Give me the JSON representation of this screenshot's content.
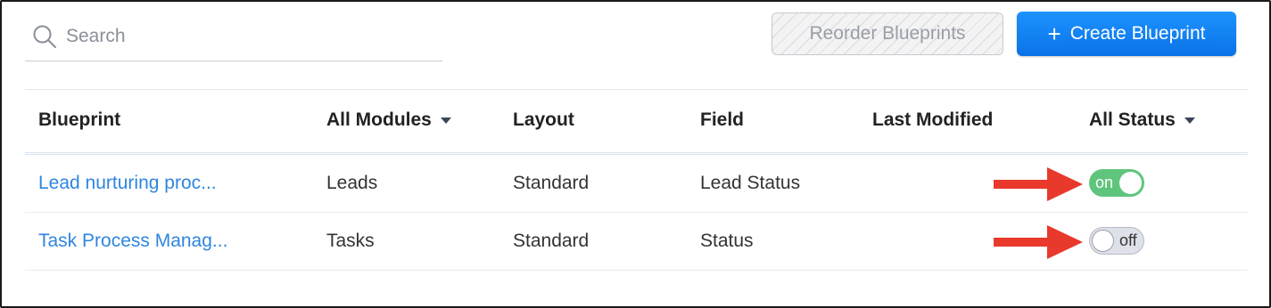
{
  "search": {
    "placeholder": "Search",
    "icon": "search-icon"
  },
  "toolbar": {
    "reorder_label": "Reorder Blueprints",
    "create_label": "Create Blueprint",
    "create_icon": "plus-icon",
    "accent": "#0a84ff"
  },
  "table": {
    "headers": {
      "blueprint": "Blueprint",
      "modules": "All Modules",
      "layout": "Layout",
      "field": "Field",
      "last_modified": "Last Modified",
      "status": "All Status"
    },
    "rows": [
      {
        "blueprint": "Lead nurturing proc...",
        "module": "Leads",
        "layout": "Standard",
        "field": "Lead Status",
        "last_modified": "",
        "status": "on"
      },
      {
        "blueprint": "Task Process Manag...",
        "module": "Tasks",
        "layout": "Standard",
        "field": "Status",
        "last_modified": "",
        "status": "off"
      }
    ]
  },
  "annotations": {
    "arrow_color": "#e8392c"
  }
}
